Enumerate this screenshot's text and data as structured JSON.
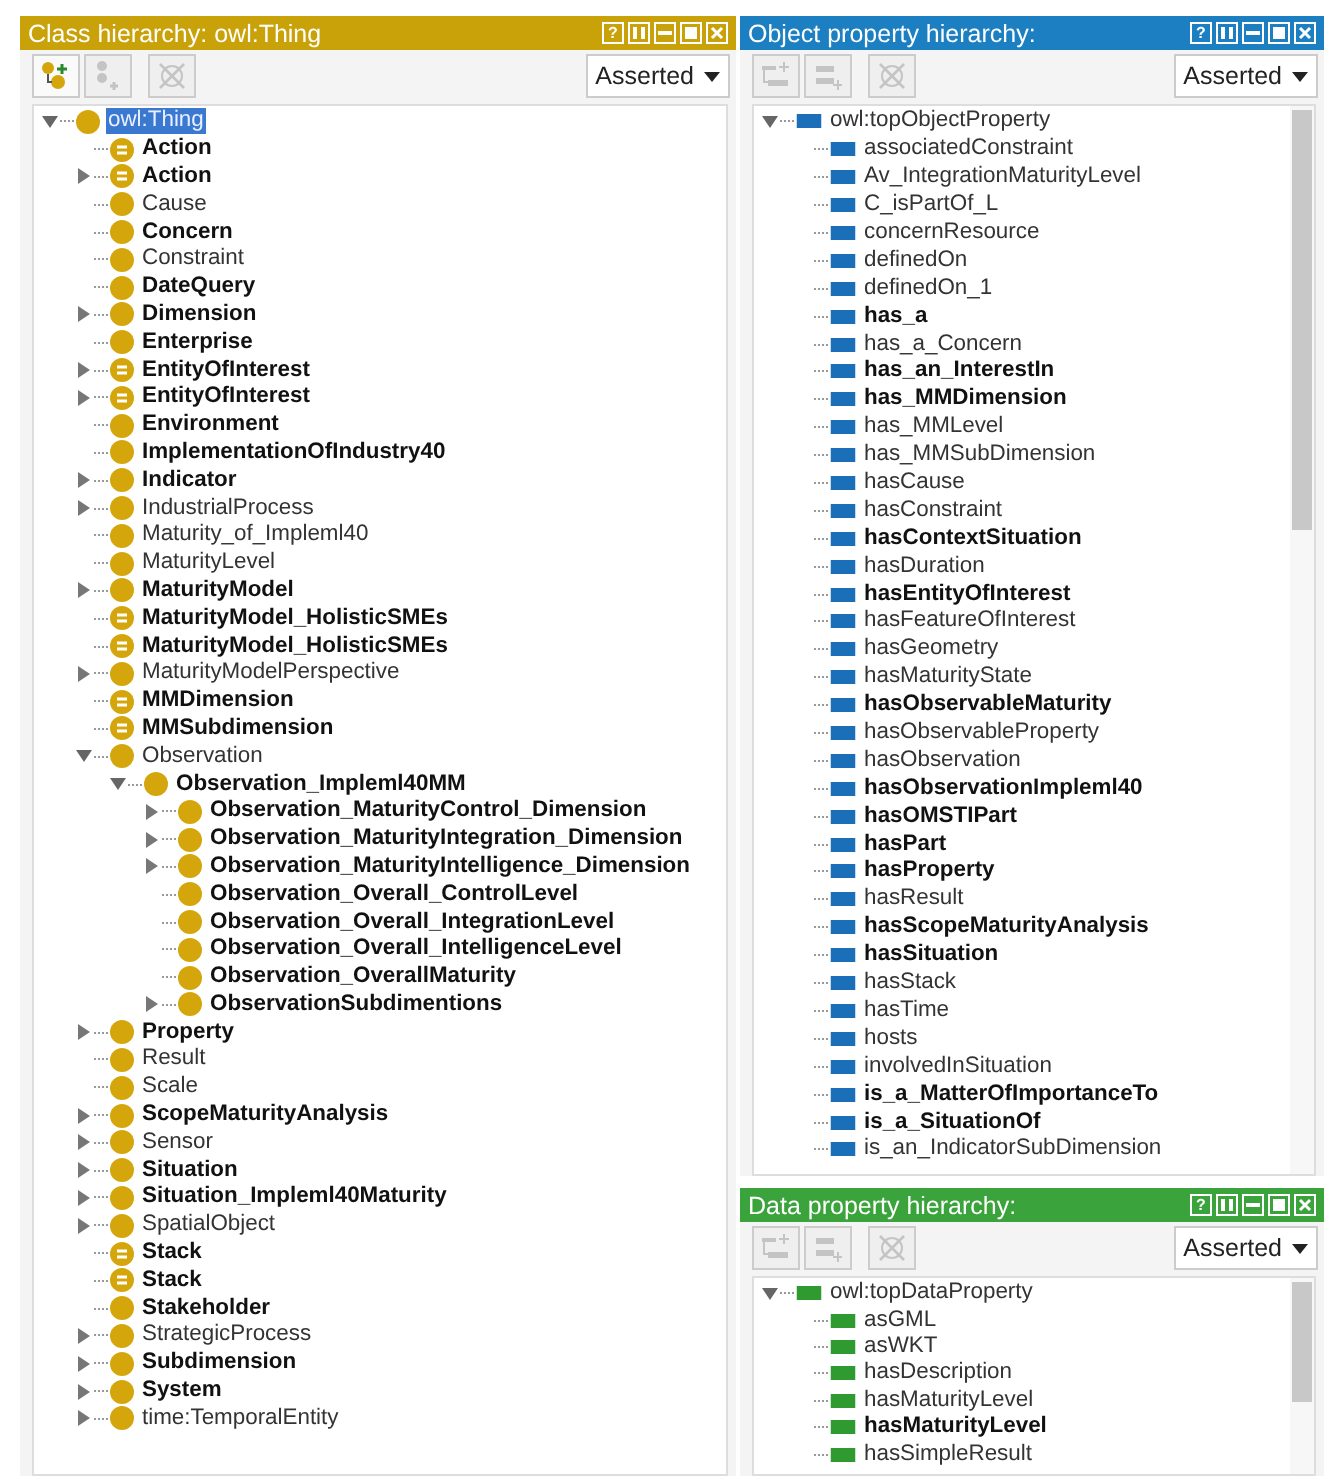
{
  "panels": [
    {
      "title": "Class hierarchy: owl:Thing",
      "color": "#c9a20a",
      "kind": "class",
      "help": "?",
      "view": "Asserted",
      "buttons": [
        {
          "kind": "add-child",
          "disabled": false
        },
        {
          "kind": "add-sibling",
          "disabled": true
        },
        {
          "kind": "delete",
          "disabled": true
        }
      ],
      "tree": [
        {
          "label": "owl:Thing",
          "bold": false,
          "defined": false,
          "kind": "expanded",
          "selected": true,
          "children": [
            {
              "label": "Action",
              "bold": true,
              "defined": true,
              "kind": "leaf",
              "selected": false
            },
            {
              "label": "Action",
              "bold": true,
              "defined": true,
              "kind": "collapsed",
              "selected": false
            },
            {
              "label": "Cause",
              "bold": false,
              "defined": false,
              "kind": "leaf",
              "selected": false
            },
            {
              "label": "Concern",
              "bold": true,
              "defined": false,
              "kind": "leaf",
              "selected": false
            },
            {
              "label": "Constraint",
              "bold": false,
              "defined": false,
              "kind": "leaf",
              "selected": false
            },
            {
              "label": "DateQuery",
              "bold": true,
              "defined": false,
              "kind": "leaf",
              "selected": false
            },
            {
              "label": "Dimension",
              "bold": true,
              "defined": false,
              "kind": "collapsed",
              "selected": false
            },
            {
              "label": "Enterprise",
              "bold": true,
              "defined": false,
              "kind": "leaf",
              "selected": false
            },
            {
              "label": "EntityOfInterest",
              "bold": true,
              "defined": true,
              "kind": "collapsed",
              "selected": false
            },
            {
              "label": "EntityOfInterest",
              "bold": true,
              "defined": true,
              "kind": "collapsed",
              "selected": false
            },
            {
              "label": "Environment",
              "bold": true,
              "defined": false,
              "kind": "leaf",
              "selected": false
            },
            {
              "label": "ImplementationOfIndustry40",
              "bold": true,
              "defined": false,
              "kind": "leaf",
              "selected": false
            },
            {
              "label": "Indicator",
              "bold": true,
              "defined": false,
              "kind": "collapsed",
              "selected": false
            },
            {
              "label": "IndustrialProcess",
              "bold": false,
              "defined": false,
              "kind": "collapsed",
              "selected": false
            },
            {
              "label": "Maturity_of_Impleml40",
              "bold": false,
              "defined": false,
              "kind": "leaf",
              "selected": false
            },
            {
              "label": "MaturityLevel",
              "bold": false,
              "defined": false,
              "kind": "leaf",
              "selected": false
            },
            {
              "label": "MaturityModel",
              "bold": true,
              "defined": false,
              "kind": "collapsed",
              "selected": false
            },
            {
              "label": "MaturityModel_HolisticSMEs",
              "bold": true,
              "defined": true,
              "kind": "leaf",
              "selected": false
            },
            {
              "label": "MaturityModel_HolisticSMEs",
              "bold": true,
              "defined": true,
              "kind": "leaf",
              "selected": false
            },
            {
              "label": "MaturityModelPerspective",
              "bold": false,
              "defined": false,
              "kind": "collapsed",
              "selected": false
            },
            {
              "label": "MMDimension",
              "bold": true,
              "defined": true,
              "kind": "leaf",
              "selected": false
            },
            {
              "label": "MMSubdimension",
              "bold": true,
              "defined": true,
              "kind": "leaf",
              "selected": false
            },
            {
              "label": "Observation",
              "bold": false,
              "defined": false,
              "kind": "expanded",
              "selected": false,
              "children": [
                {
                  "label": "Observation_Impleml40MM",
                  "bold": true,
                  "defined": false,
                  "kind": "expanded",
                  "selected": false,
                  "children": [
                    {
                      "label": "Observation_MaturityControl_Dimension",
                      "bold": true,
                      "defined": false,
                      "kind": "collapsed",
                      "selected": false
                    },
                    {
                      "label": "Observation_MaturityIntegration_Dimension",
                      "bold": true,
                      "defined": false,
                      "kind": "collapsed",
                      "selected": false
                    },
                    {
                      "label": "Observation_MaturityIntelligence_Dimension",
                      "bold": true,
                      "defined": false,
                      "kind": "collapsed",
                      "selected": false
                    },
                    {
                      "label": "Observation_Overall_ControlLevel",
                      "bold": true,
                      "defined": false,
                      "kind": "leaf",
                      "selected": false
                    },
                    {
                      "label": "Observation_Overall_IntegrationLevel",
                      "bold": true,
                      "defined": false,
                      "kind": "leaf",
                      "selected": false
                    },
                    {
                      "label": "Observation_Overall_IntelligenceLevel",
                      "bold": true,
                      "defined": false,
                      "kind": "leaf",
                      "selected": false
                    },
                    {
                      "label": "Observation_OverallMaturity",
                      "bold": true,
                      "defined": false,
                      "kind": "leaf",
                      "selected": false
                    },
                    {
                      "label": "ObservationSubdimentions",
                      "bold": true,
                      "defined": false,
                      "kind": "collapsed",
                      "selected": false
                    }
                  ]
                }
              ]
            },
            {
              "label": "Property",
              "bold": true,
              "defined": false,
              "kind": "collapsed",
              "selected": false
            },
            {
              "label": "Result",
              "bold": false,
              "defined": false,
              "kind": "leaf",
              "selected": false
            },
            {
              "label": "Scale",
              "bold": false,
              "defined": false,
              "kind": "leaf",
              "selected": false
            },
            {
              "label": "ScopeMaturityAnalysis",
              "bold": true,
              "defined": false,
              "kind": "collapsed",
              "selected": false
            },
            {
              "label": "Sensor",
              "bold": false,
              "defined": false,
              "kind": "collapsed",
              "selected": false
            },
            {
              "label": "Situation",
              "bold": true,
              "defined": false,
              "kind": "collapsed",
              "selected": false
            },
            {
              "label": "Situation_Impleml40Maturity",
              "bold": true,
              "defined": false,
              "kind": "collapsed",
              "selected": false
            },
            {
              "label": "SpatialObject",
              "bold": false,
              "defined": false,
              "kind": "collapsed",
              "selected": false
            },
            {
              "label": "Stack",
              "bold": true,
              "defined": true,
              "kind": "leaf",
              "selected": false
            },
            {
              "label": "Stack",
              "bold": true,
              "defined": true,
              "kind": "leaf",
              "selected": false
            },
            {
              "label": "Stakeholder",
              "bold": true,
              "defined": false,
              "kind": "leaf",
              "selected": false
            },
            {
              "label": "StrategicProcess",
              "bold": false,
              "defined": false,
              "kind": "collapsed",
              "selected": false
            },
            {
              "label": "Subdimension",
              "bold": true,
              "defined": false,
              "kind": "collapsed",
              "selected": false
            },
            {
              "label": "System",
              "bold": true,
              "defined": false,
              "kind": "collapsed",
              "selected": false
            },
            {
              "label": "time:TemporalEntity",
              "bold": false,
              "defined": false,
              "kind": "collapsed",
              "selected": false
            }
          ]
        }
      ]
    },
    {
      "title": "Object property hierarchy:",
      "color": "#1b7fc2",
      "kind": "object-property",
      "help": "?",
      "view": "Asserted",
      "buttons": [
        {
          "kind": "add-child",
          "disabled": true
        },
        {
          "kind": "add-sibling",
          "disabled": true
        },
        {
          "kind": "delete",
          "disabled": true
        }
      ],
      "tree": [
        {
          "label": "owl:topObjectProperty",
          "bold": false,
          "kind": "expanded",
          "selected": false,
          "children": [
            {
              "label": "associatedConstraint",
              "bold": false,
              "kind": "leaf",
              "selected": false
            },
            {
              "label": "Av_IntegrationMaturityLevel",
              "bold": false,
              "kind": "leaf",
              "selected": false
            },
            {
              "label": "C_isPartOf_L",
              "bold": false,
              "kind": "leaf",
              "selected": false
            },
            {
              "label": "concernResource",
              "bold": false,
              "kind": "leaf",
              "selected": false
            },
            {
              "label": "definedOn",
              "bold": false,
              "kind": "leaf",
              "selected": false
            },
            {
              "label": "definedOn_1",
              "bold": false,
              "kind": "leaf",
              "selected": false
            },
            {
              "label": "has_a",
              "bold": true,
              "kind": "leaf",
              "selected": false
            },
            {
              "label": "has_a_Concern",
              "bold": false,
              "kind": "leaf",
              "selected": false
            },
            {
              "label": "has_an_InterestIn",
              "bold": true,
              "kind": "leaf",
              "selected": false
            },
            {
              "label": "has_MMDimension",
              "bold": true,
              "kind": "leaf",
              "selected": false
            },
            {
              "label": "has_MMLevel",
              "bold": false,
              "kind": "leaf",
              "selected": false
            },
            {
              "label": "has_MMSubDimension",
              "bold": false,
              "kind": "leaf",
              "selected": false
            },
            {
              "label": "hasCause",
              "bold": false,
              "kind": "leaf",
              "selected": false
            },
            {
              "label": "hasConstraint",
              "bold": false,
              "kind": "leaf",
              "selected": false
            },
            {
              "label": "hasContextSituation",
              "bold": true,
              "kind": "leaf",
              "selected": false
            },
            {
              "label": "hasDuration",
              "bold": false,
              "kind": "leaf",
              "selected": false
            },
            {
              "label": "hasEntityOfInterest",
              "bold": true,
              "kind": "leaf",
              "selected": false
            },
            {
              "label": "hasFeatureOfInterest",
              "bold": false,
              "kind": "leaf",
              "selected": false
            },
            {
              "label": "hasGeometry",
              "bold": false,
              "kind": "leaf",
              "selected": false
            },
            {
              "label": "hasMaturityState",
              "bold": false,
              "kind": "leaf",
              "selected": false
            },
            {
              "label": "hasObservableMaturity",
              "bold": true,
              "kind": "leaf",
              "selected": false
            },
            {
              "label": "hasObservableProperty",
              "bold": false,
              "kind": "leaf",
              "selected": false
            },
            {
              "label": "hasObservation",
              "bold": false,
              "kind": "leaf",
              "selected": false
            },
            {
              "label": "hasObservationImpleml40",
              "bold": true,
              "kind": "leaf",
              "selected": false
            },
            {
              "label": "hasOMSTIPart",
              "bold": true,
              "kind": "leaf",
              "selected": false
            },
            {
              "label": "hasPart",
              "bold": true,
              "kind": "leaf",
              "selected": false
            },
            {
              "label": "hasProperty",
              "bold": true,
              "kind": "leaf",
              "selected": false
            },
            {
              "label": "hasResult",
              "bold": false,
              "kind": "leaf",
              "selected": false
            },
            {
              "label": "hasScopeMaturityAnalysis",
              "bold": true,
              "kind": "leaf",
              "selected": false
            },
            {
              "label": "hasSituation",
              "bold": true,
              "kind": "leaf",
              "selected": false
            },
            {
              "label": "hasStack",
              "bold": false,
              "kind": "leaf",
              "selected": false
            },
            {
              "label": "hasTime",
              "bold": false,
              "kind": "leaf",
              "selected": false
            },
            {
              "label": "hosts",
              "bold": false,
              "kind": "leaf",
              "selected": false
            },
            {
              "label": "involvedInSituation",
              "bold": false,
              "kind": "leaf",
              "selected": false
            },
            {
              "label": "is_a_MatterOfImportanceTo",
              "bold": true,
              "kind": "leaf",
              "selected": false
            },
            {
              "label": "is_a_SituationOf",
              "bold": true,
              "kind": "leaf",
              "selected": false
            },
            {
              "label": "is_an_IndicatorSubDimension",
              "bold": false,
              "kind": "leaf",
              "selected": false
            }
          ]
        }
      ]
    },
    {
      "title": "Data property hierarchy:",
      "color": "#3ba33b",
      "kind": "data-property",
      "help": "?",
      "view": "Asserted",
      "buttons": [
        {
          "kind": "add-child",
          "disabled": true
        },
        {
          "kind": "add-sibling",
          "disabled": true
        },
        {
          "kind": "delete",
          "disabled": true
        }
      ],
      "tree": [
        {
          "label": "owl:topDataProperty",
          "bold": false,
          "kind": "expanded",
          "selected": false,
          "children": [
            {
              "label": "asGML",
              "bold": false,
              "kind": "leaf",
              "selected": false
            },
            {
              "label": "asWKT",
              "bold": false,
              "kind": "leaf",
              "selected": false
            },
            {
              "label": "hasDescription",
              "bold": false,
              "kind": "leaf",
              "selected": false
            },
            {
              "label": "hasMaturityLevel",
              "bold": false,
              "kind": "leaf",
              "selected": false
            },
            {
              "label": "hasMaturityLevel",
              "bold": true,
              "kind": "leaf",
              "selected": false
            },
            {
              "label": "hasSimpleResult",
              "bold": false,
              "kind": "leaf",
              "selected": false
            }
          ]
        }
      ]
    }
  ]
}
